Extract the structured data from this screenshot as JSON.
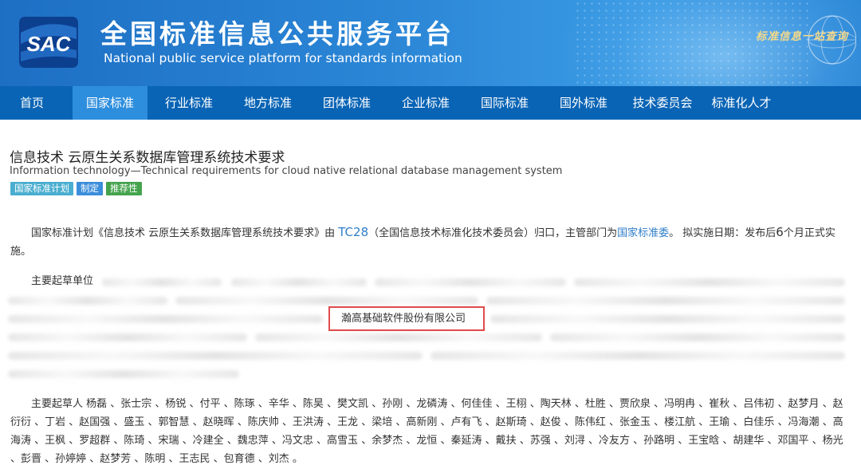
{
  "header": {
    "logo_text": "SAC",
    "title_cn": "全国标准信息公共服务平台",
    "title_en": "National public service platform  for standards information",
    "calligraphy": "标准信息一站查询"
  },
  "nav": {
    "items": [
      {
        "label": "首页"
      },
      {
        "label": "国家标准"
      },
      {
        "label": "行业标准"
      },
      {
        "label": "地方标准"
      },
      {
        "label": "团体标准"
      },
      {
        "label": "企业标准"
      },
      {
        "label": "国际标准"
      },
      {
        "label": "国外标准"
      },
      {
        "label": "技术委员会"
      },
      {
        "label": "标准化人才"
      }
    ],
    "active_index": 1
  },
  "standard": {
    "title_cn": "信息技术 云原生关系数据库管理系统技术要求",
    "title_en": "Information technology—Technical requirements for cloud native relational database management system",
    "badges": [
      "国家标准计划",
      "制定",
      "推荐性"
    ]
  },
  "description": {
    "part1": "国家标准计划《信息技术 云原生关系数据库管理系统技术要求》由 ",
    "tc_link": "TC28",
    "part2": "（全国信息技术标准化技术委员会）归口，主管部门为",
    "dept_link": "国家标准委",
    "part3": "。 拟实施日期：发布后",
    "months": "6",
    "part4": "个月正式实施。"
  },
  "drafting": {
    "units_label": "主要起草单位",
    "highlighted_unit": "瀚高基础软件股份有限公司",
    "people_text": "主要起草人 杨磊 、张士宗 、杨锐 、付平 、陈琢 、辛华 、陈昊 、樊文凯 、孙刚 、龙磷涛 、何佳佳 、王栩 、陶天林 、杜胜 、贾欣泉 、冯明冉 、崔秋 、吕伟初 、赵梦月 、赵衍衍 、丁岩 、赵国强 、盛玉 、郭智慧 、赵晓晖 、陈庆帅 、王洪涛 、王龙 、梁培 、高新刚 、卢有飞 、赵斯琦 、赵俊 、陈伟红 、张金玉 、楼江航 、王瑜 、白佳乐 、冯海潮 、高海涛 、王枫 、罗超群 、陈琦 、宋瑞 、冷建全 、魏忠萍 、冯文忠 、高雪玉 、余梦杰 、龙恒 、秦延涛 、戴扶 、苏强 、刘浔 、冷友方 、孙路明 、王宝晗 、胡建华 、邓国平 、杨光 、彭晋 、孙婷婷 、赵梦芳 、陈明 、王志民 、包育德 、刘杰 。"
  },
  "colors": {
    "header_blue": "#2b86d6",
    "nav_blue": "#0a64b5",
    "nav_active": "#2e8ede",
    "link_blue": "#2f7ec9",
    "highlight_border": "#e04b4b",
    "calligraphy_gold": "#f4d98a"
  }
}
